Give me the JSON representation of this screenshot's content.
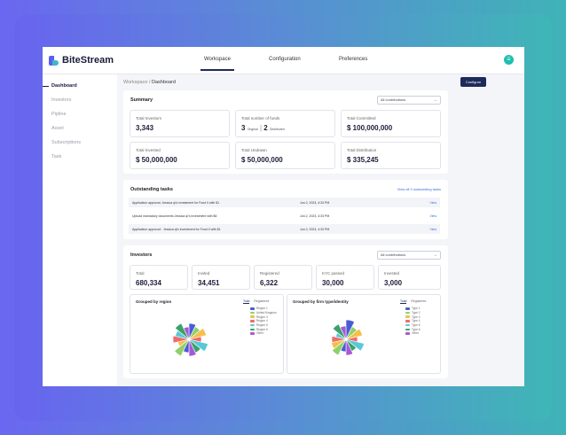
{
  "app": {
    "brand": "BiteStream"
  },
  "topnav": [
    {
      "label": "Workspace",
      "active": true
    },
    {
      "label": "Configuration",
      "active": false
    },
    {
      "label": "Preferences",
      "active": false
    }
  ],
  "sidebar": [
    {
      "label": "Dashboard",
      "active": true
    },
    {
      "label": "Investors"
    },
    {
      "label": "Pipline"
    },
    {
      "label": "Asset"
    },
    {
      "label": "Subscriptions"
    },
    {
      "label": "Task"
    }
  ],
  "breadcrumb": {
    "root": "Workspace",
    "sep": "/",
    "current": "Dashboard"
  },
  "configure_label": "Configure",
  "summary": {
    "title": "Summary",
    "filter": "All contributions",
    "stats": [
      {
        "label": "Total Investors",
        "value": "3,343"
      },
      {
        "label": "Total number of funds",
        "value_a": "3",
        "sub_a": "Original",
        "value_b": "2",
        "sub_b": "Distributed"
      },
      {
        "label": "Total Committed",
        "value": "$ 100,000,000"
      },
      {
        "label": "Total Invested",
        "value": "$ 50,000,000"
      },
      {
        "label": "Total Undrawn",
        "value": "$ 50,000,000"
      },
      {
        "label": "Total Distribution",
        "value": "$ 335,245"
      }
    ]
  },
  "tasks": {
    "title": "Outstanding tasks",
    "view_all": "View all 3 outstanding tasks",
    "rows": [
      {
        "text": "Application approval, Jessica ql's investment for Fund II with $1",
        "date": "Jun 2, 2023, 4:33 PM",
        "action": "View"
      },
      {
        "text": "Upload mandatory documents Jessica ql's investment with $6",
        "date": "Jun 2, 2023, 4:33 PM",
        "action": "View"
      },
      {
        "text": "Application approval：Jessica ql's investment for Fund II with $1",
        "date": "Jun 2, 2023, 4:33 PM",
        "action": "View"
      }
    ]
  },
  "investors": {
    "title": "Investors",
    "filter": "All contributions",
    "stats": [
      {
        "label": "Total",
        "value": "680,334"
      },
      {
        "label": "Invited",
        "value": "34,451"
      },
      {
        "label": "Registered",
        "value": "6,322"
      },
      {
        "label": "KYC passed",
        "value": "30,000"
      },
      {
        "label": "Invested",
        "value": "3,000"
      }
    ]
  },
  "region_chart": {
    "title": "Grouped by region",
    "tabs": [
      "Total",
      "Registered"
    ],
    "legend": [
      "Region 1",
      "United Kingdom",
      "Region 3",
      "Region 4",
      "Region 5",
      "Region 6",
      "Other"
    ],
    "colors": [
      "#4a5bd4",
      "#8fd16a",
      "#f4c04c",
      "#ef6b6b",
      "#5bc8d6",
      "#3aa26a",
      "#a957d6"
    ]
  },
  "type_chart": {
    "title": "Grouped by firm type/identity",
    "tabs": [
      "Total",
      "Registered"
    ],
    "legend": [
      "Type 1",
      "Type 2",
      "Type 3",
      "Type 4",
      "Type 5",
      "Type 6",
      "Other"
    ],
    "colors": [
      "#4a5bd4",
      "#8fd16a",
      "#f4c04c",
      "#ef6b6b",
      "#5bc8d6",
      "#3aa26a",
      "#a957d6"
    ]
  }
}
